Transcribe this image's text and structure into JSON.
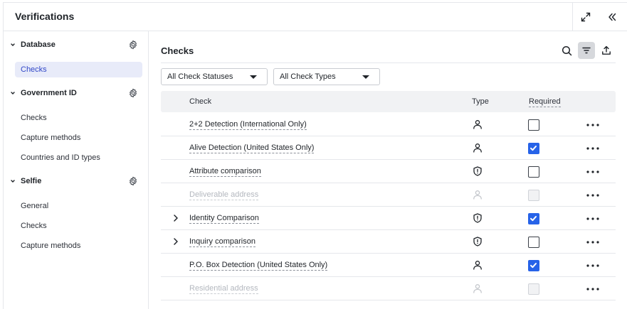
{
  "header": {
    "title": "Verifications"
  },
  "sidebar": {
    "sections": [
      {
        "title": "Database",
        "items": [
          {
            "label": "Checks",
            "active": true
          }
        ]
      },
      {
        "title": "Government ID",
        "items": [
          {
            "label": "Checks"
          },
          {
            "label": "Capture methods"
          },
          {
            "label": "Countries and ID types"
          }
        ]
      },
      {
        "title": "Selfie",
        "items": [
          {
            "label": "General"
          },
          {
            "label": "Checks"
          },
          {
            "label": "Capture methods"
          }
        ]
      }
    ]
  },
  "main": {
    "title": "Checks",
    "filters": {
      "status": "All Check Statuses",
      "type": "All Check Types"
    },
    "columns": {
      "check": "Check",
      "type": "Type",
      "required": "Required"
    },
    "rows": [
      {
        "name": "2+2 Detection (International Only)",
        "type_icon": "person-icon",
        "required": false,
        "disabled": false,
        "expandable": false
      },
      {
        "name": "Alive Detection (United States Only)",
        "type_icon": "person-icon",
        "required": true,
        "disabled": false,
        "expandable": false
      },
      {
        "name": "Attribute comparison",
        "type_icon": "shield-alert-icon",
        "required": false,
        "disabled": false,
        "expandable": false
      },
      {
        "name": "Deliverable address",
        "type_icon": "person-icon",
        "required": false,
        "disabled": true,
        "expandable": false
      },
      {
        "name": "Identity Comparison",
        "type_icon": "shield-alert-icon",
        "required": true,
        "disabled": false,
        "expandable": true
      },
      {
        "name": "Inquiry comparison",
        "type_icon": "shield-alert-icon",
        "required": false,
        "disabled": false,
        "expandable": true
      },
      {
        "name": "P.O. Box Detection (United States Only)",
        "type_icon": "person-icon",
        "required": true,
        "disabled": false,
        "expandable": false
      },
      {
        "name": "Residential address",
        "type_icon": "person-icon",
        "required": false,
        "disabled": true,
        "expandable": false
      }
    ]
  },
  "colors": {
    "accent": "#2763e8",
    "active_bg": "#e8ebf9",
    "active_text": "#3248c8",
    "disabled_text": "#b4b8bf"
  }
}
